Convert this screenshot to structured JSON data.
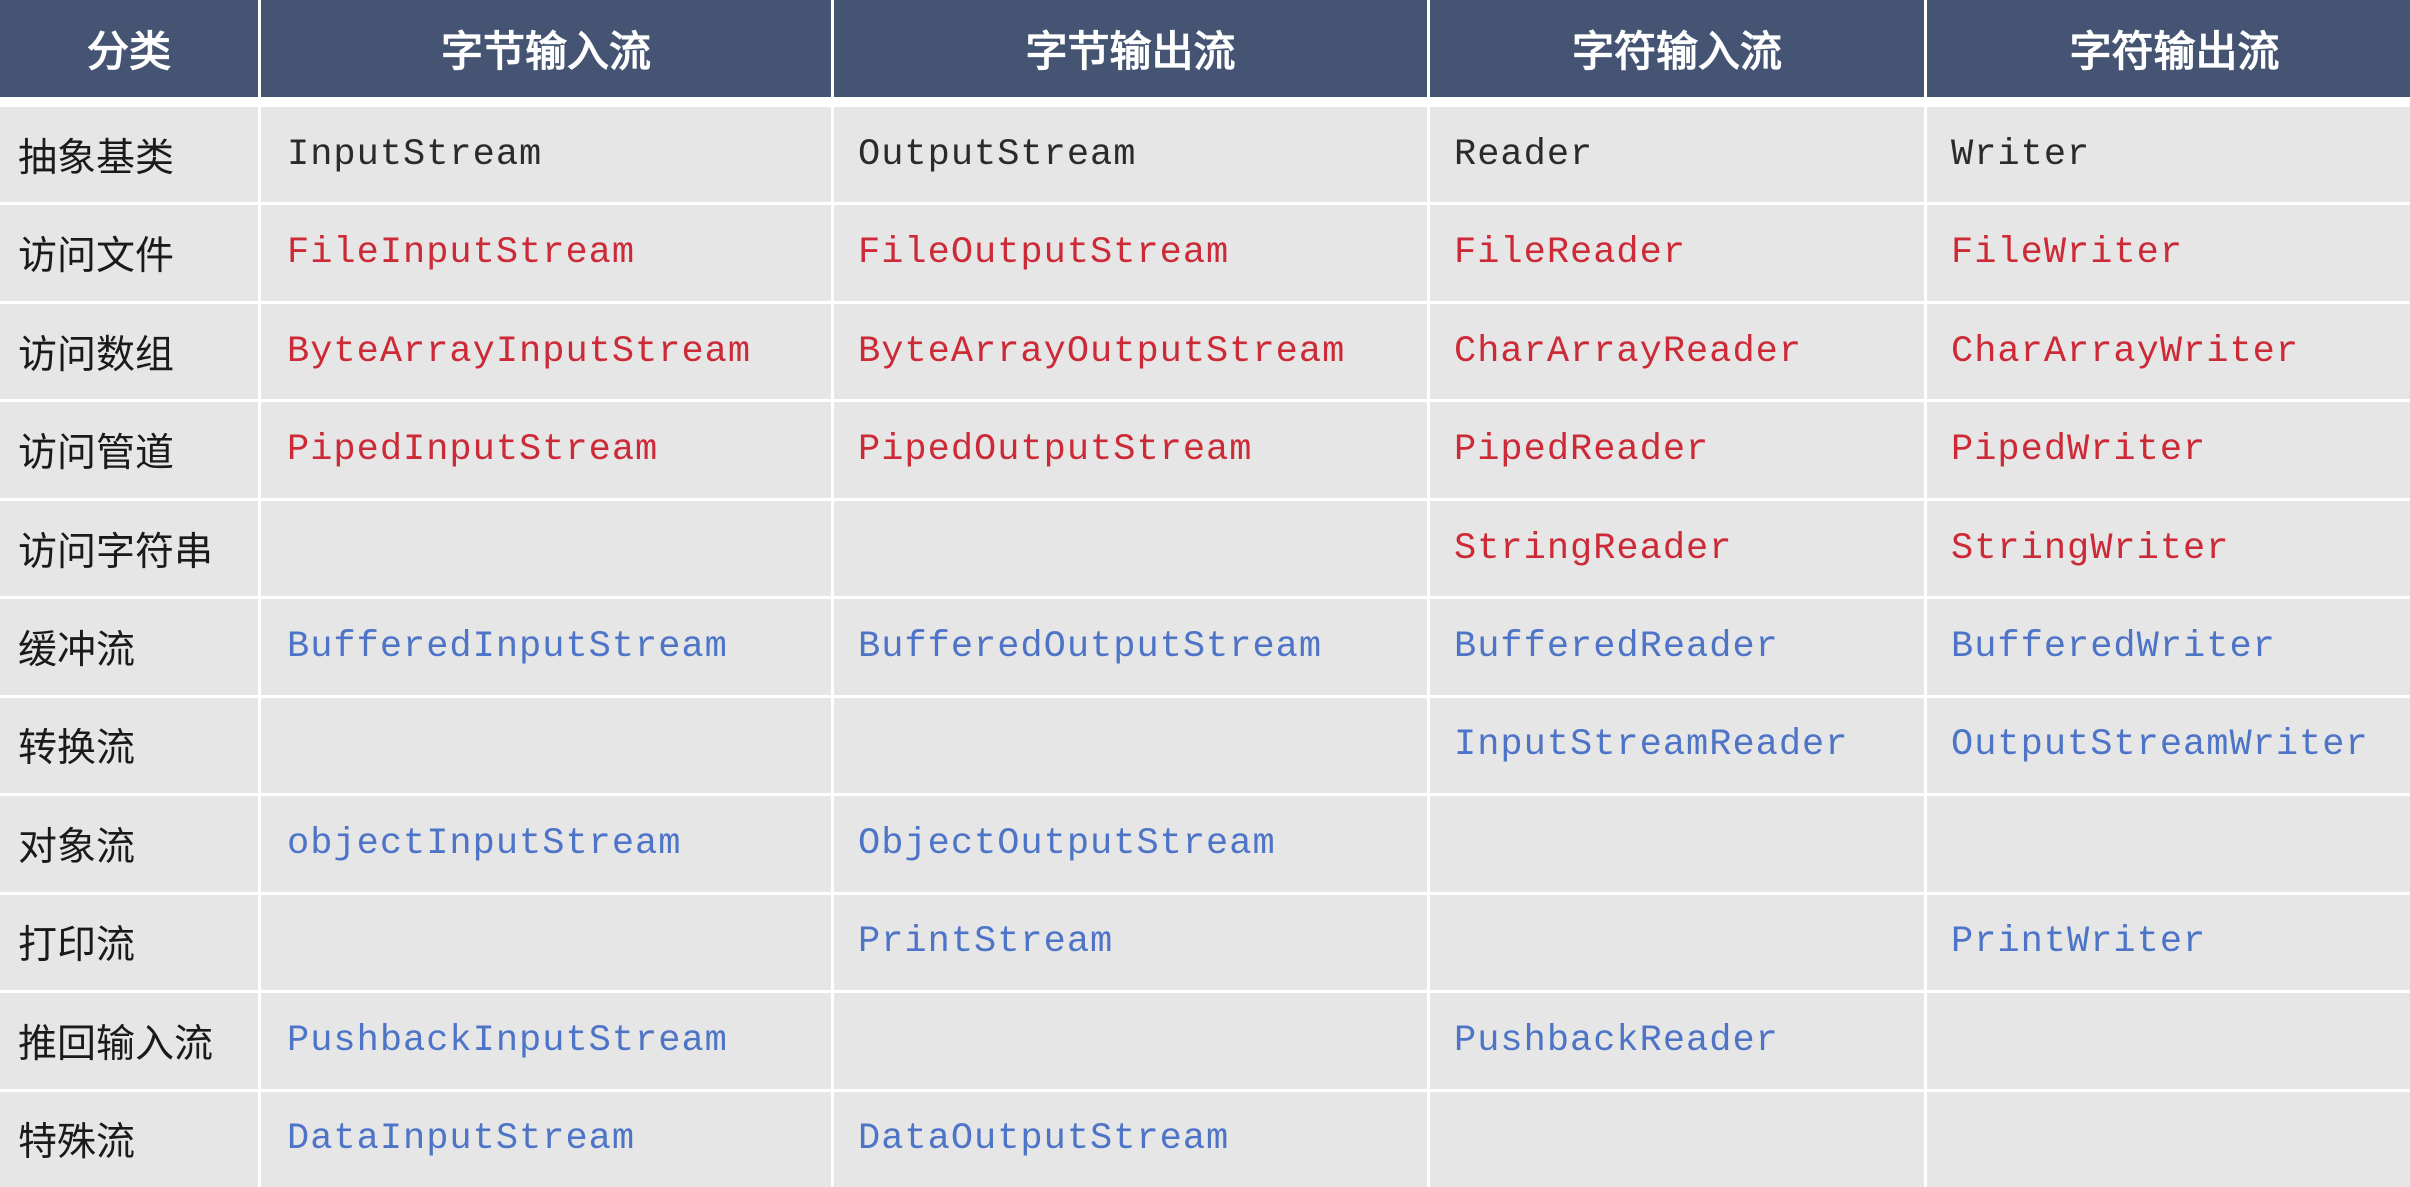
{
  "colors": {
    "header_bg": "#445472",
    "cell_bg": "#e6e6e6",
    "abstract_text": "#2b2b2b",
    "node_stream_text": "#cc2a36",
    "processing_stream_text": "#4d74c7"
  },
  "headers": [
    "分类",
    "字节输入流",
    "字节输出流",
    "字符输入流",
    "字符输出流"
  ],
  "rows": [
    {
      "category": "抽象基类",
      "cells": [
        "InputStream",
        "OutputStream",
        "Reader",
        "Writer"
      ],
      "color": "black"
    },
    {
      "category": "访问文件",
      "cells": [
        "FileInputStream",
        "FileOutputStream",
        "FileReader",
        "FileWriter"
      ],
      "color": "red"
    },
    {
      "category": "访问数组",
      "cells": [
        "ByteArrayInputStream",
        "ByteArrayOutputStream",
        "CharArrayReader",
        "CharArrayWriter"
      ],
      "color": "red"
    },
    {
      "category": "访问管道",
      "cells": [
        "PipedInputStream",
        "PipedOutputStream",
        "PipedReader",
        "PipedWriter"
      ],
      "color": "red"
    },
    {
      "category": "访问字符串",
      "cells": [
        "",
        "",
        "StringReader",
        "StringWriter"
      ],
      "color": "red"
    },
    {
      "category": "缓冲流",
      "cells": [
        "BufferedInputStream",
        "BufferedOutputStream",
        "BufferedReader",
        "BufferedWriter"
      ],
      "color": "blue"
    },
    {
      "category": "转换流",
      "cells": [
        "",
        "",
        "InputStreamReader",
        "OutputStreamWriter"
      ],
      "color": "blue"
    },
    {
      "category": "对象流",
      "cells": [
        "objectInputStream",
        "ObjectOutputStream",
        "",
        ""
      ],
      "color": "blue"
    },
    {
      "category": "打印流",
      "cells": [
        "",
        "PrintStream",
        "",
        "PrintWriter"
      ],
      "color": "blue"
    },
    {
      "category": "推回输入流",
      "cells": [
        "PushbackInputStream",
        "",
        "PushbackReader",
        ""
      ],
      "color": "blue"
    },
    {
      "category": "特殊流",
      "cells": [
        "DataInputStream",
        "DataOutputStream",
        "",
        ""
      ],
      "color": "blue"
    }
  ]
}
